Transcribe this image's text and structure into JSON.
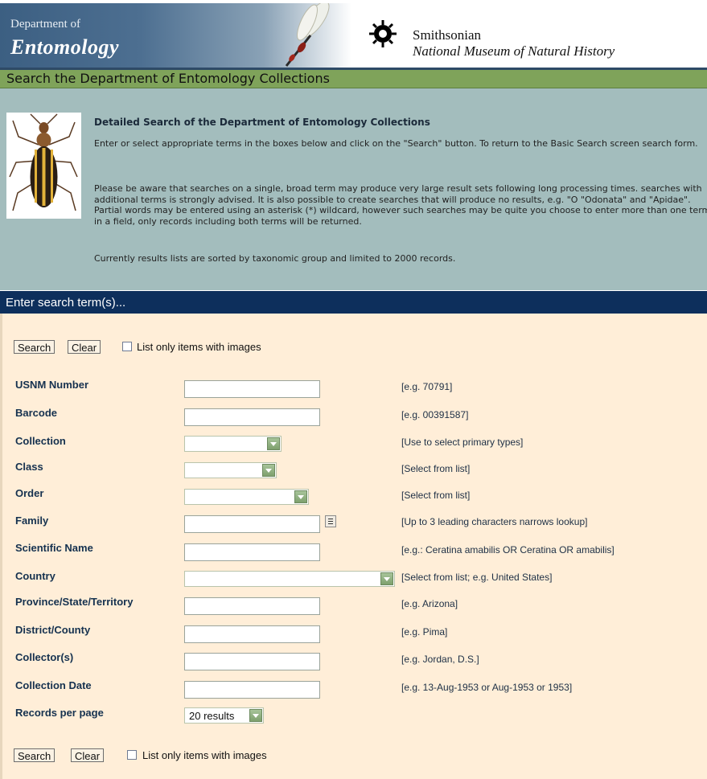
{
  "banner": {
    "dept_of": "Department of",
    "dept_title": "Entomology",
    "si_name": "Smithsonian",
    "si_museum": "National Museum of Natural History"
  },
  "green_bar": {
    "title": "Search the Department of Entomology Collections"
  },
  "intro": {
    "heading": "Detailed Search of the Department of Entomology Collections",
    "p1": "Enter or select appropriate terms in the boxes below and click on the \"Search\" button. To return to the Basic Search screen search form.",
    "p2": "Please be aware that searches on a single, broad term may produce very large result sets following long processing times. searches with additional terms is strongly advised. It is also possible to create searches that will produce no results, e.g. \"O \"Odonata\" and \"Apidae\". Partial words may be entered using an asterisk (*) wildcard, however such searches may be quite you choose to enter more than one term in a field, only records including both terms will be returned.",
    "p3": "Currently results lists are sorted by taxonomic group and limited to 2000 records."
  },
  "search_header": {
    "title": "Enter search term(s)..."
  },
  "buttons": {
    "search": "Search",
    "clear": "Clear",
    "images_only": "List only items with images"
  },
  "fields": {
    "usnm": {
      "label": "USNM Number",
      "hint": "[e.g. 70791]",
      "value": ""
    },
    "barcode": {
      "label": "Barcode",
      "hint": "[e.g. 00391587]",
      "value": ""
    },
    "collection": {
      "label": "Collection",
      "hint": "[Use to select primary types]",
      "value": ""
    },
    "class": {
      "label": "Class",
      "hint": "[Select from list]",
      "value": ""
    },
    "order": {
      "label": "Order",
      "hint": "[Select from list]",
      "value": ""
    },
    "family": {
      "label": "Family",
      "hint": "[Up to 3 leading characters narrows lookup]",
      "value": ""
    },
    "sciname": {
      "label": "Scientific Name",
      "hint": "[e.g.: Ceratina amabilis OR Ceratina OR amabilis]",
      "value": ""
    },
    "country": {
      "label": "Country",
      "hint": "[Select from list; e.g. United States]",
      "value": ""
    },
    "province": {
      "label": "Province/State/Territory",
      "hint": "[e.g. Arizona]",
      "value": ""
    },
    "district": {
      "label": "District/County",
      "hint": "[e.g. Pima]",
      "value": ""
    },
    "collector": {
      "label": "Collector(s)",
      "hint": "[e.g. Jordan, D.S.]",
      "value": ""
    },
    "coldate": {
      "label": "Collection Date",
      "hint": "[e.g. 13-Aug-1953 or Aug-1953 or 1953]",
      "value": ""
    },
    "records": {
      "label": "Records per page",
      "value": "20 results"
    }
  },
  "colors": {
    "banner_blue": "#3c5f82",
    "green_bar": "#7fa35a",
    "intro_bg": "#a3bdbd",
    "navy": "#0d2f5c",
    "form_bg": "#ffeed8"
  }
}
